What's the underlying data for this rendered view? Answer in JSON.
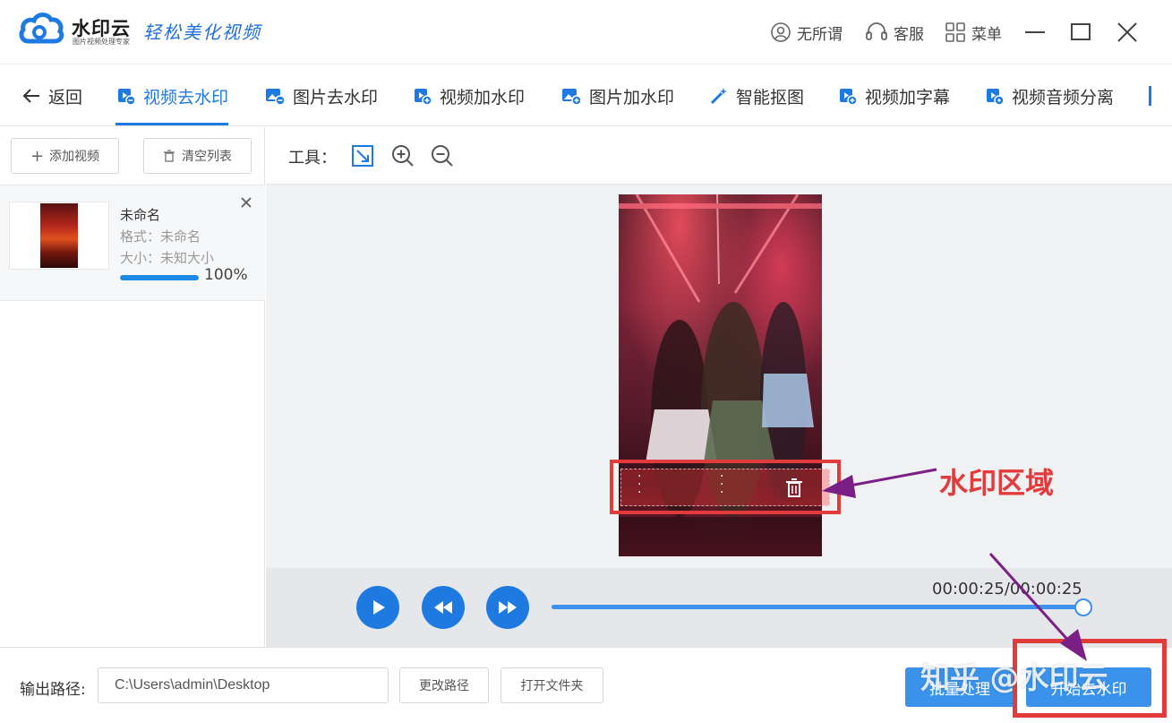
{
  "app": {
    "brand": "水印云",
    "brand_sub": "图片视频处理专家",
    "slogan": "轻松美化视频"
  },
  "titlebar": {
    "nothing_label": "无所谓",
    "service_label": "客服",
    "menu_label": "菜单"
  },
  "tabs": {
    "back": "返回",
    "items": [
      {
        "label": "视频去水印",
        "active": true
      },
      {
        "label": "图片去水印"
      },
      {
        "label": "视频加水印"
      },
      {
        "label": "图片加水印"
      },
      {
        "label": "智能抠图"
      },
      {
        "label": "视频加字幕"
      },
      {
        "label": "视频音频分离"
      }
    ]
  },
  "left": {
    "add_video": "添加视频",
    "clear_list": "清空列表",
    "file": {
      "name": "未命名",
      "format": "格式：未命名",
      "size": "大小：未知大小",
      "progress": 1.0,
      "progress_text": "100%"
    }
  },
  "tools": {
    "label": "工具："
  },
  "preview": {
    "annotation": "水印区域",
    "time": "00:00:25/00:00:25",
    "seek_fraction": 1.0
  },
  "bottom": {
    "output_label": "输出路径:",
    "output_path": "C:\\Users\\admin\\Desktop",
    "change_path": "更改路径",
    "open_folder": "打开文件夹",
    "batch": "批量处理",
    "start": "开始去水印"
  },
  "overlay": {
    "watermark_text": "知乎 @水印云"
  },
  "colors": {
    "accent": "#1e7ae0",
    "annotation_red": "#e23b3b",
    "arrow_purple": "#7a1f86"
  }
}
